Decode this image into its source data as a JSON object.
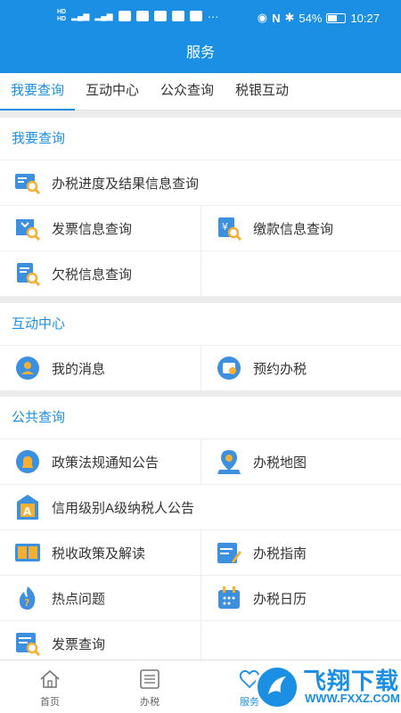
{
  "status_bar": {
    "battery": "54%",
    "time": "10:27"
  },
  "header": {
    "title": "服务"
  },
  "tabs": [
    {
      "label": "我要查询"
    },
    {
      "label": "互动中心"
    },
    {
      "label": "公众查询"
    },
    {
      "label": "税银互动"
    }
  ],
  "sections": {
    "query": {
      "title": "我要查询",
      "items": [
        {
          "label": "办税进度及结果信息查询",
          "icon": "search-doc-icon"
        },
        {
          "label": "发票信息查询",
          "icon": "invoice-search-icon"
        },
        {
          "label": "缴款信息查询",
          "icon": "payment-search-icon"
        },
        {
          "label": "欠税信息查询",
          "icon": "arrears-search-icon"
        }
      ]
    },
    "interaction": {
      "title": "互动中心",
      "items": [
        {
          "label": "我的消息",
          "icon": "user-message-icon"
        },
        {
          "label": "预约办税",
          "icon": "appointment-icon"
        }
      ]
    },
    "public": {
      "title": "公共查询",
      "items": [
        {
          "label": "政策法规通知公告",
          "icon": "bell-icon"
        },
        {
          "label": "办税地图",
          "icon": "map-pin-icon"
        },
        {
          "label": "信用级别A级纳税人公告",
          "icon": "credit-a-icon"
        },
        {
          "label": "税收政策及解读",
          "icon": "book-icon"
        },
        {
          "label": "办税指南",
          "icon": "guide-icon"
        },
        {
          "label": "热点问题",
          "icon": "hot-question-icon"
        },
        {
          "label": "办税日历",
          "icon": "calendar-icon"
        },
        {
          "label": "发票查询",
          "icon": "invoice-icon"
        }
      ]
    }
  },
  "bottom_nav": [
    {
      "label": "首页",
      "icon": "home-icon"
    },
    {
      "label": "办税",
      "icon": "list-icon"
    },
    {
      "label": "服务",
      "icon": "heart-icon"
    }
  ],
  "watermark": {
    "text": "飞翔下载",
    "url": "WWW.FXXZ.COM"
  },
  "colors": {
    "primary": "#1a8fe3",
    "icon_blue": "#3d8fe0",
    "icon_orange": "#f5b032"
  }
}
